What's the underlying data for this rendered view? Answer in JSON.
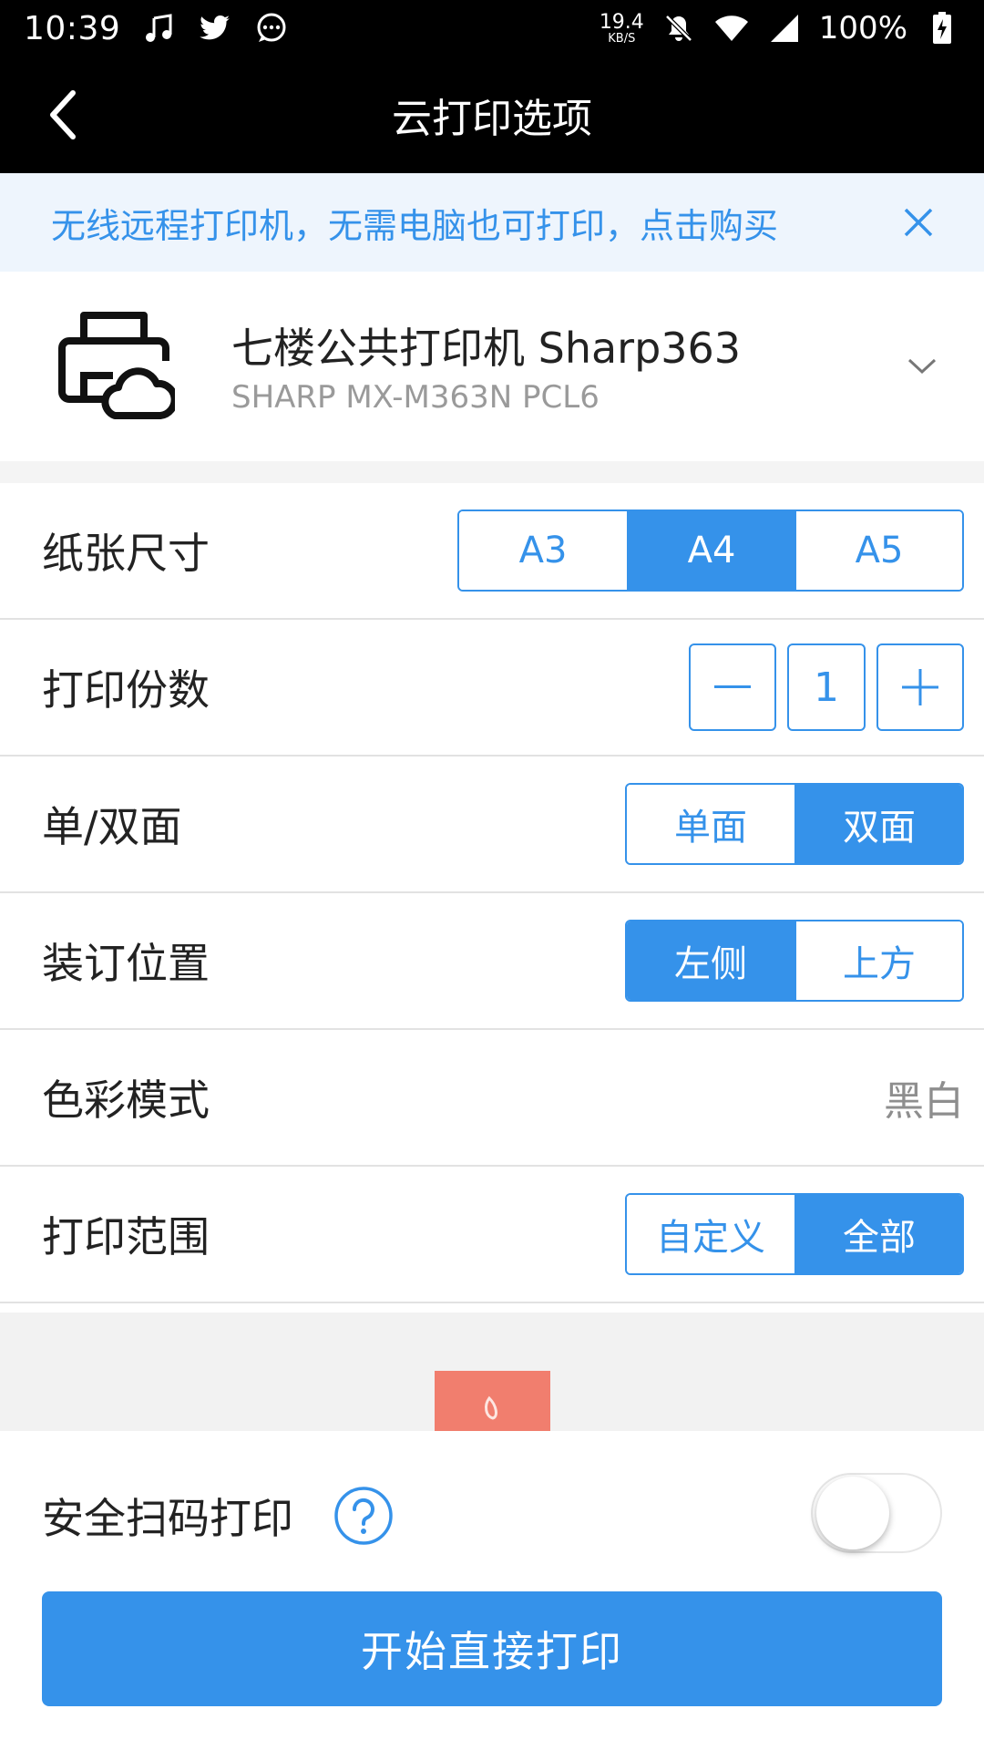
{
  "status_bar": {
    "time": "10:39",
    "net_speed_value": "19.4",
    "net_speed_unit": "KB/S",
    "battery": "100%",
    "icons": [
      "music-icon",
      "twitter-icon",
      "chat-icon",
      "mute-icon",
      "wifi-icon",
      "signal-icon",
      "battery-charging-icon"
    ]
  },
  "header": {
    "title": "云打印选项",
    "back_icon": "back-arrow-icon"
  },
  "banner": {
    "text": "无线远程打印机，无需电脑也可打印，点击购买",
    "close_icon": "close-icon"
  },
  "printer": {
    "name": "七楼公共打印机 Sharp363",
    "model": "SHARP MX-M363N PCL6",
    "icon": "cloud-printer-icon"
  },
  "options": {
    "paper_size": {
      "label": "纸张尺寸",
      "choices": [
        "A3",
        "A4",
        "A5"
      ],
      "selected": "A4"
    },
    "copies": {
      "label": "打印份数",
      "minus": "−",
      "value": "1",
      "plus": "+"
    },
    "duplex": {
      "label": "单/双面",
      "choices": [
        "单面",
        "双面"
      ],
      "selected": "双面"
    },
    "binding": {
      "label": "装订位置",
      "choices": [
        "左侧",
        "上方"
      ],
      "selected": "左侧"
    },
    "color": {
      "label": "色彩模式",
      "value": "黑白"
    },
    "range": {
      "label": "打印范围",
      "choices": [
        "自定义",
        "全部"
      ],
      "selected": "全部"
    }
  },
  "secure_print": {
    "label": "安全扫码打印",
    "help_icon": "help-icon",
    "enabled": false
  },
  "action": {
    "print_label": "开始直接打印"
  },
  "colors": {
    "accent": "#3592ea",
    "banner_bg": "#eef5fd",
    "preview_page": "#f17e6e"
  }
}
